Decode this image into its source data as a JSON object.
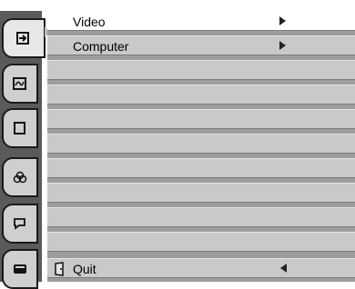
{
  "menu": {
    "items": [
      {
        "label": "Video",
        "submenu": true,
        "selected": true
      },
      {
        "label": "Computer",
        "submenu": true,
        "selected": false
      },
      {
        "label": ""
      },
      {
        "label": ""
      },
      {
        "label": ""
      },
      {
        "label": ""
      },
      {
        "label": ""
      },
      {
        "label": ""
      },
      {
        "label": ""
      },
      {
        "label": ""
      }
    ],
    "quit": {
      "label": "Quit"
    }
  },
  "tabs": [
    {
      "icon": "input-icon",
      "active": true
    },
    {
      "icon": "image-adjust-icon"
    },
    {
      "icon": "screen-icon"
    },
    {
      "icon": "color-icon"
    },
    {
      "icon": "setting-icon"
    },
    {
      "icon": "info-icon"
    }
  ],
  "colors": {
    "menu_bg": "#9d9d9d",
    "row_bg": "#c9c9c9",
    "selected_row": "#ffffff",
    "tab_bg": "#cfcfcf"
  }
}
